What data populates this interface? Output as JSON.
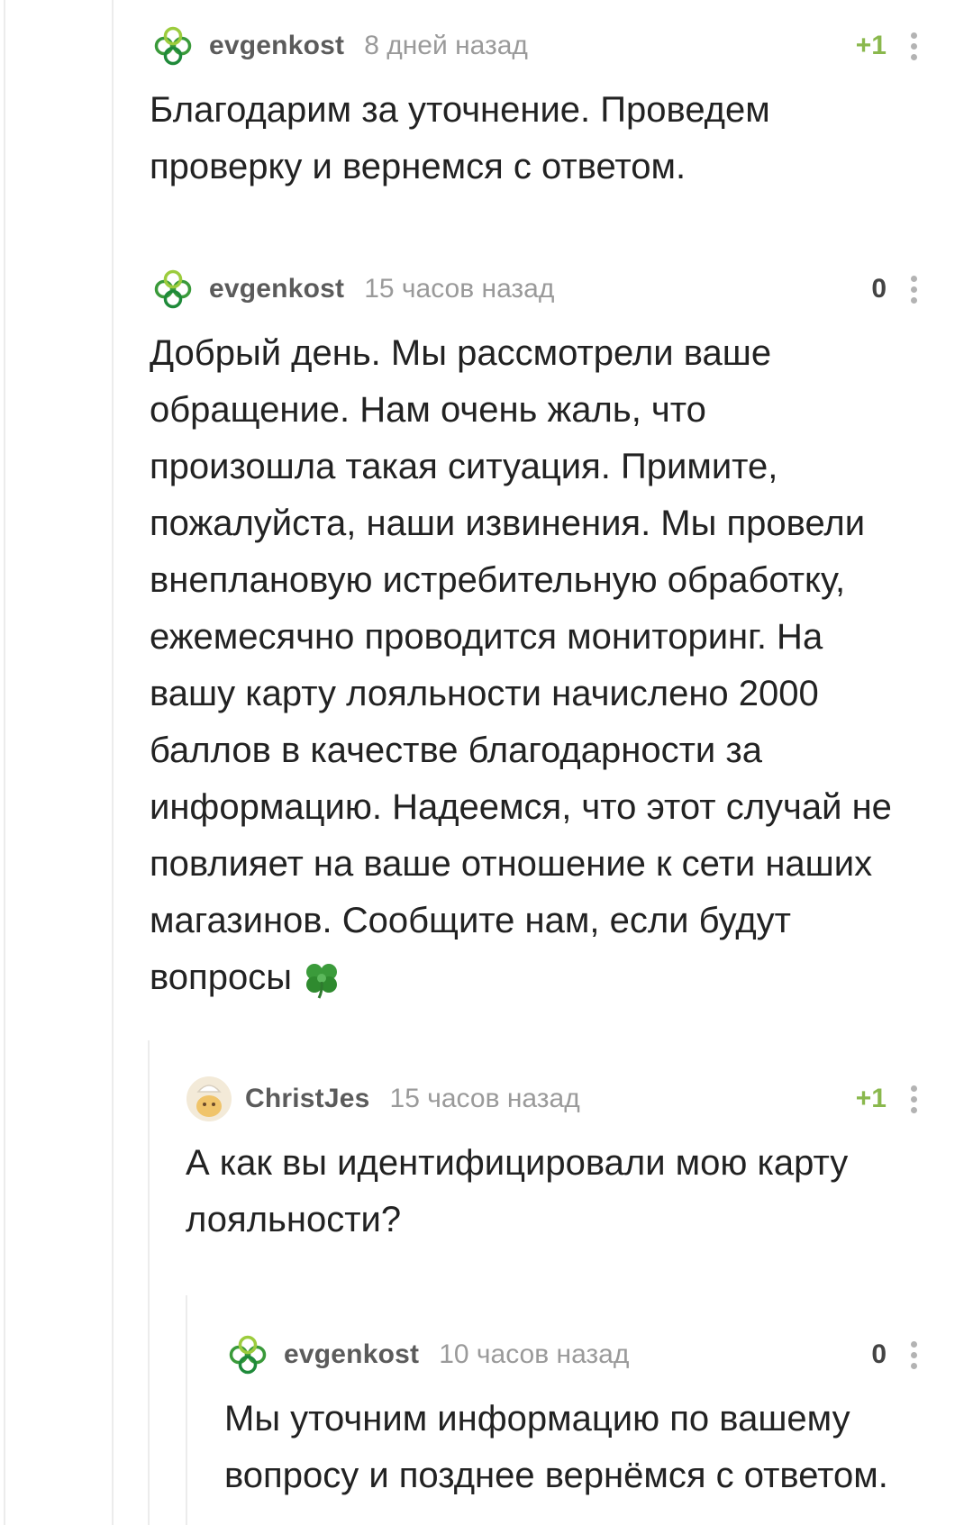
{
  "colors": {
    "rating_positive": "#8ab84d",
    "rating_neutral": "#444444",
    "username": "#5b5b5b",
    "timestamp": "#9a9a9a",
    "text": "#222222",
    "thread_line": "#ececec"
  },
  "comments": [
    {
      "avatar_icon": "clover-logo-icon",
      "username": "evgenkost",
      "time": "8 дней назад",
      "rating": "+1",
      "text": "Благодарим за уточнение. Проведем\nпроверку и вернемся с ответом."
    },
    {
      "avatar_icon": "clover-logo-icon",
      "username": "evgenkost",
      "time": "15 часов назад",
      "rating": "0",
      "text": "Добрый день. Мы рассмотрели ваше\nобращение. Нам очень жаль, что\nпроизошла такая ситуация. Примите,\nпожалуйста, наши извинения. Мы провели\nвнеплановую истребительную обработку,\nежемесячно проводится мониторинг. На\nвашу карту лояльности начислено 2000\nбаллов в качестве благодарности за\nинформацию. Надеемся, что этот случай не\nповлияет на ваше отношение к сети наших\nмагазинов. Сообщите нам, если будут\nвопросы",
      "trailing_emoji": "four-leaf-clover-emoji"
    },
    {
      "avatar_icon": "user-avatar-icon",
      "username": "ChristJes",
      "time": "15 часов назад",
      "rating": "+1",
      "text": "А как вы идентифицировали мою карту\nлояльности?"
    },
    {
      "avatar_icon": "clover-logo-icon",
      "username": "evgenkost",
      "time": "10 часов назад",
      "rating": "0",
      "text": "Мы уточним информацию по вашему\nвопросу и позднее вернёмся с ответом."
    }
  ]
}
